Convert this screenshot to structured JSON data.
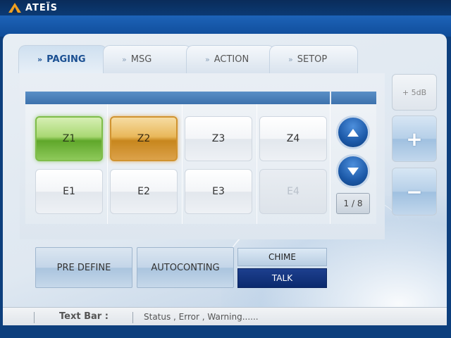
{
  "app": {
    "brand": "ATEÏS"
  },
  "tabs": [
    {
      "label": "PAGING",
      "chevron": "»",
      "active": true
    },
    {
      "label": "MSG",
      "chevron": "»",
      "active": false
    },
    {
      "label": "ACTION",
      "chevron": "»",
      "active": false
    },
    {
      "label": "SETOP",
      "chevron": "»",
      "active": false
    }
  ],
  "zones": {
    "row1": [
      {
        "label": "Z1",
        "state": "green"
      },
      {
        "label": "Z2",
        "state": "orange"
      },
      {
        "label": "Z3",
        "state": "normal"
      },
      {
        "label": "Z4",
        "state": "normal"
      }
    ],
    "row2": [
      {
        "label": "E1",
        "state": "normal"
      },
      {
        "label": "E2",
        "state": "normal"
      },
      {
        "label": "E3",
        "state": "normal"
      },
      {
        "label": "E4",
        "state": "disabled"
      }
    ]
  },
  "pager": {
    "indicator": "1 / 8",
    "up_icon": "arrow-up-icon",
    "down_icon": "arrow-down-icon"
  },
  "volume": {
    "level_label": "+ 5dB",
    "plus_icon": "plus-icon",
    "minus_icon": "minus-icon"
  },
  "actions": {
    "pre_define": "PRE DEFINE",
    "autoconting": "AUTOCONTING",
    "chime": "CHIME",
    "talk": "TALK"
  },
  "statusbar": {
    "label": "Text Bar :",
    "message": "Status , Error , Warning......"
  },
  "colors": {
    "accent_blue": "#1a4f92",
    "zone_active_green": "#7fbd4a",
    "zone_active_orange": "#d09330",
    "talk_bg": "#0b2a6e"
  }
}
